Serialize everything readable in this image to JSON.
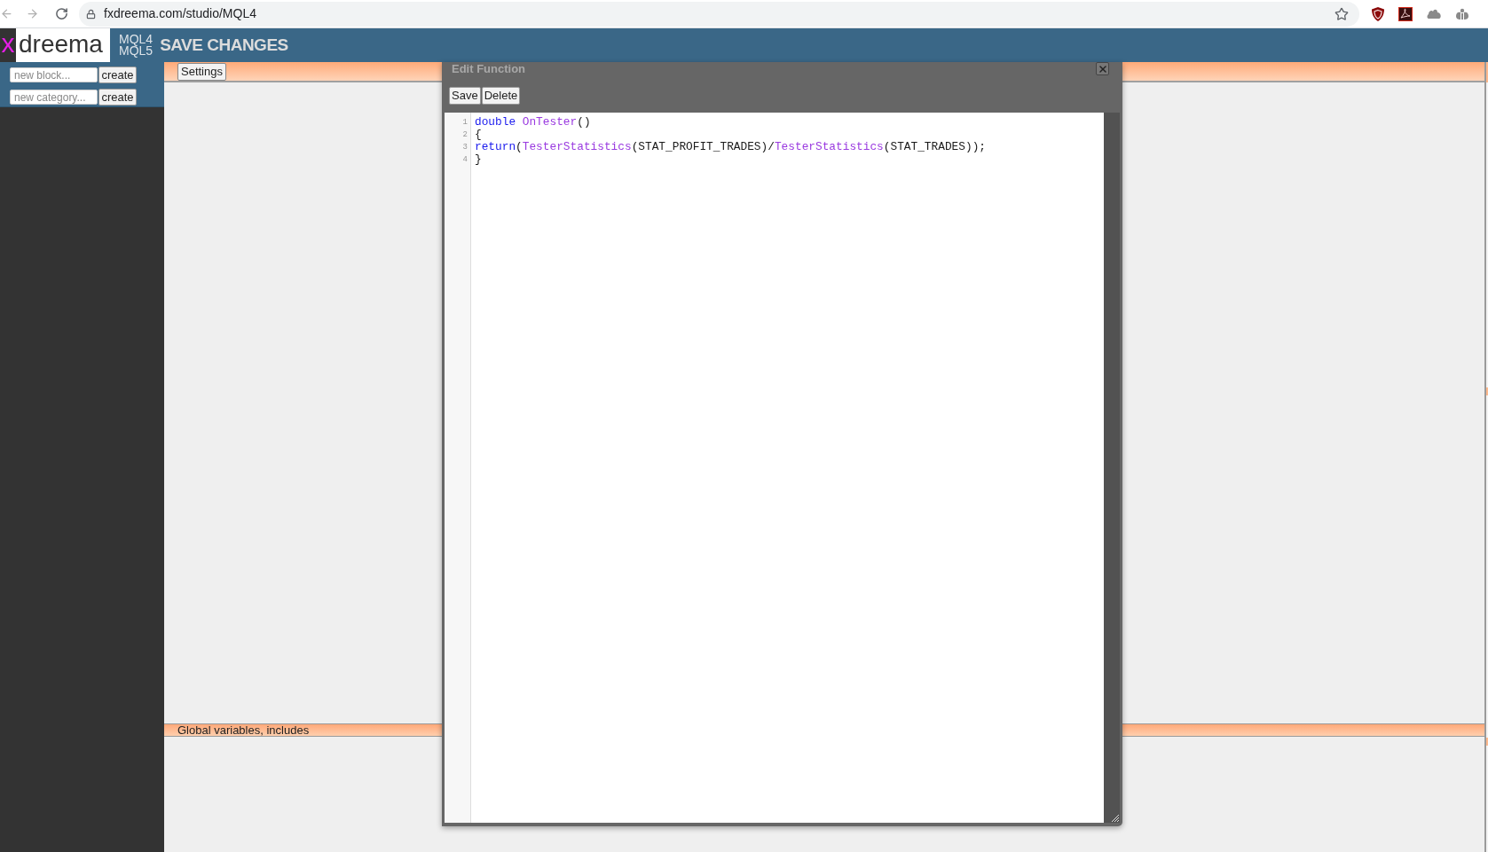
{
  "browser": {
    "url": "fxdreema.com/studio/MQL4"
  },
  "header": {
    "logo_mark": "x",
    "logo_text": "dreema",
    "platforms": [
      "MQL4",
      "MQL5"
    ],
    "save_label": "SAVE CHANGES"
  },
  "sidebar": {
    "creators": [
      {
        "placeholder": "new block...",
        "button": "create"
      },
      {
        "placeholder": "new category...",
        "button": "create"
      }
    ]
  },
  "workspace": {
    "sections": [
      {
        "kind": "button_bar",
        "label": "Settings"
      },
      {
        "kind": "title_bar",
        "label": "Global variables, includes"
      }
    ]
  },
  "dialog": {
    "title": "Edit Function",
    "buttons": [
      "Save",
      "Delete"
    ],
    "code_lines": [
      {
        "number": "1",
        "tokens": [
          {
            "text": "double ",
            "kind": "keyword"
          },
          {
            "text": "OnTester",
            "kind": "function"
          },
          {
            "text": "()",
            "kind": "plain"
          }
        ]
      },
      {
        "number": "2",
        "tokens": [
          {
            "text": "{",
            "kind": "plain"
          }
        ]
      },
      {
        "number": "3",
        "tokens": [
          {
            "text": "return",
            "kind": "keyword"
          },
          {
            "text": "(",
            "kind": "plain"
          },
          {
            "text": "TesterStatistics",
            "kind": "function"
          },
          {
            "text": "(STAT_PROFIT_TRADES)/",
            "kind": "plain"
          },
          {
            "text": "TesterStatistics",
            "kind": "function"
          },
          {
            "text": "(STAT_TRADES));",
            "kind": "plain"
          }
        ]
      },
      {
        "number": "4",
        "tokens": [
          {
            "text": "}",
            "kind": "plain"
          }
        ]
      }
    ]
  }
}
